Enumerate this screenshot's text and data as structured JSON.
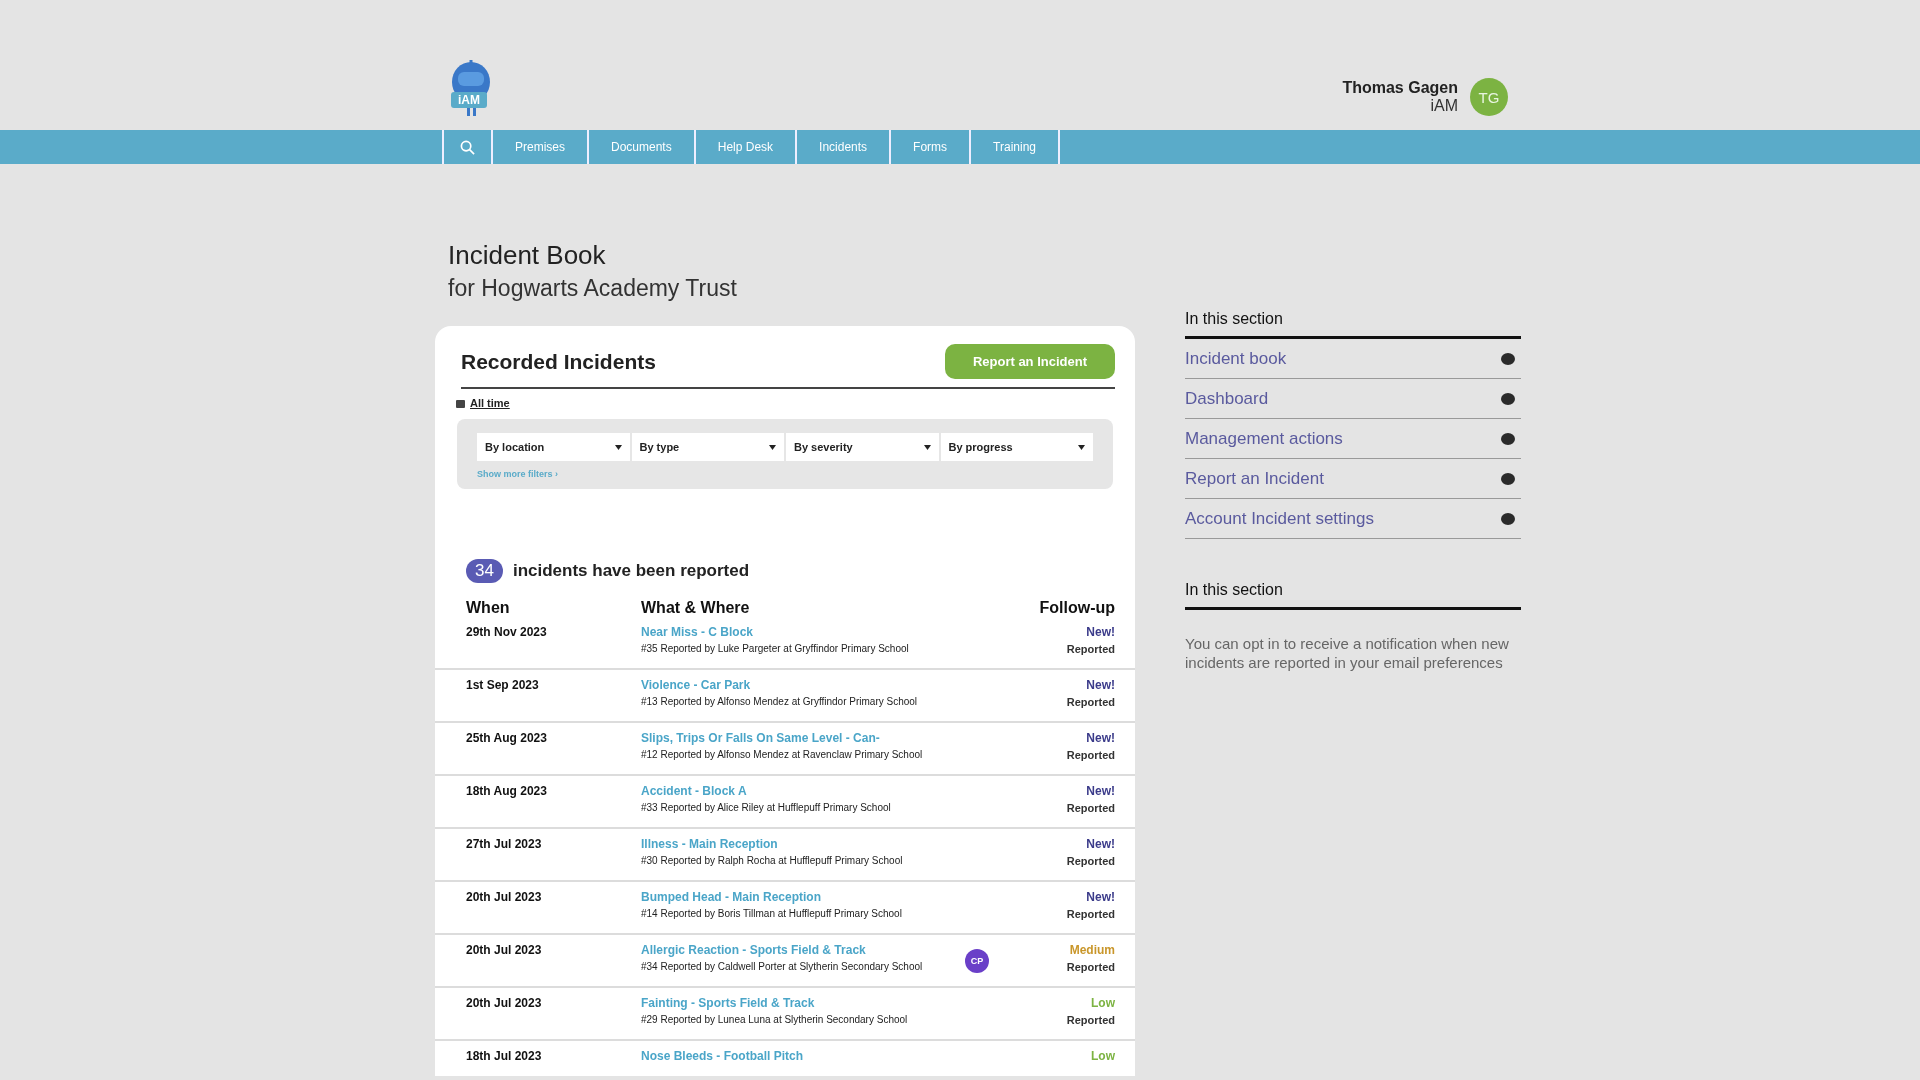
{
  "logo": {
    "text": "iAM"
  },
  "user": {
    "name": "Thomas Gagen",
    "org": "iAM",
    "initials": "TG"
  },
  "nav": {
    "items": [
      "Premises",
      "Documents",
      "Help Desk",
      "Incidents",
      "Forms",
      "Training"
    ]
  },
  "page": {
    "title": "Incident Book",
    "subtitle": "for Hogwarts Academy Trust"
  },
  "card": {
    "title": "Recorded Incidents",
    "report_button": "Report an Incident",
    "period": "All time",
    "filters": [
      "By location",
      "By type",
      "By severity",
      "By progress"
    ],
    "more_filters": "Show more filters ›",
    "count": "34",
    "count_text": "incidents have been reported",
    "columns": [
      "When",
      "What & Where",
      "Follow-up"
    ],
    "rows": [
      {
        "date": "29th Nov 2023",
        "title": "Near Miss - C Block",
        "detail": "#35 Reported by Luke Pargeter at Gryffindor Primary School",
        "severity": "New!",
        "kind": "new",
        "status": "Reported"
      },
      {
        "date": "1st Sep 2023",
        "title": "Violence - Car Park",
        "detail": "#13 Reported by Alfonso Mendez at Gryffindor Primary School",
        "severity": "New!",
        "kind": "new",
        "status": "Reported"
      },
      {
        "date": "25th Aug 2023",
        "title": "Slips, Trips Or Falls On Same Level - Can-",
        "detail": "#12 Reported by Alfonso Mendez at Ravenclaw Primary School",
        "severity": "New!",
        "kind": "new",
        "status": "Reported"
      },
      {
        "date": "18th Aug 2023",
        "title": "Accident - Block A",
        "detail": "#33 Reported by Alice Riley at Hufflepuff Primary School",
        "severity": "New!",
        "kind": "new",
        "status": "Reported"
      },
      {
        "date": "27th Jul 2023",
        "title": "Illness - Main Reception",
        "detail": "#30 Reported by Ralph Rocha at Hufflepuff Primary School",
        "severity": "New!",
        "kind": "new",
        "status": "Reported"
      },
      {
        "date": "20th Jul 2023",
        "title": "Bumped Head - Main Reception",
        "detail": "#14 Reported by Boris Tillman at Hufflepuff Primary School",
        "severity": "New!",
        "kind": "new",
        "status": "Reported"
      },
      {
        "date": "20th Jul 2023",
        "title": "Allergic Reaction - Sports Field & Track",
        "detail": "#34 Reported by Caldwell Porter at Slytherin Secondary School",
        "badge": "CP",
        "severity": "Medium",
        "kind": "medium",
        "status": "Reported"
      },
      {
        "date": "20th Jul 2023",
        "title": "Fainting - Sports Field & Track",
        "detail": "#29 Reported by Lunea Luna at Slytherin Secondary School",
        "severity": "Low",
        "kind": "low",
        "status": "Reported"
      },
      {
        "date": "18th Jul 2023",
        "title": "Nose Bleeds - Football Pitch",
        "severity": "Low",
        "kind": "low"
      }
    ]
  },
  "sidebar": {
    "heading": "In this section",
    "links": [
      "Incident book",
      "Dashboard",
      "Management actions",
      "Report an Incident",
      "Account Incident settings"
    ],
    "heading_2": "In this section",
    "note": "You can opt in to receive a notification when new incidents are reported in your email preferences"
  }
}
